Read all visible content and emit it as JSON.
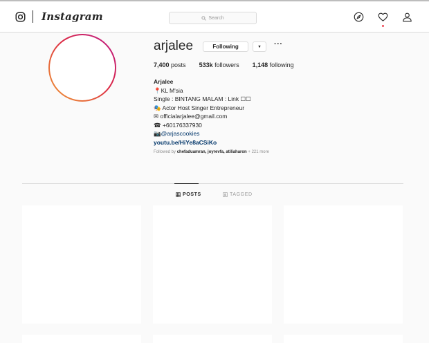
{
  "nav": {
    "wordmark": "Instagram",
    "search_placeholder": "Search",
    "icons": [
      "instagram-logo-icon",
      "search-icon",
      "compass-icon",
      "heart-icon",
      "profile-icon"
    ],
    "notification_dot_color": "#ed4956"
  },
  "profile": {
    "username": "arjalee",
    "following_button": "Following",
    "caret": "▾",
    "more": "···",
    "stats": [
      {
        "count": "7,400",
        "label": "posts"
      },
      {
        "count": "533k",
        "label": "followers"
      },
      {
        "count": "1,148",
        "label": "following"
      }
    ],
    "bio": {
      "name": "Arjalee",
      "lines": [
        "📍KL M'sia",
        "Single : BINTANG MALAM : Link ☐☐",
        "🎭 Actor Host Singer Entrepreneur",
        "✉ officialarjalee@gmail.com",
        "☎ +60176337930"
      ],
      "mention": "📷@arjascookies",
      "url": "youtu.be/HiYe8aCSiKo"
    },
    "followed_by": {
      "prefix": "Followed by",
      "names": "chefaduamran, joyrevfa, atiliaharon",
      "more": "+ 221 more"
    },
    "avatar_gradient": [
      "#f09433",
      "#e6683c",
      "#dc2743",
      "#cc2366",
      "#bc1888"
    ]
  },
  "tabs": [
    {
      "label": "POSTS",
      "active": true
    },
    {
      "label": "TAGGED",
      "active": false
    }
  ]
}
